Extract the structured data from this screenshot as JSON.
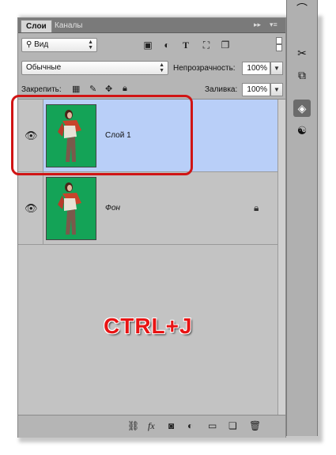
{
  "tabs": {
    "layers": "Слои",
    "channels": "Каналы"
  },
  "filter": {
    "kind": "Вид"
  },
  "blend": {
    "mode": "Обычные",
    "opacity_label": "Непрозрачность:",
    "opacity_value": "100%"
  },
  "lock": {
    "label": "Закрепить:",
    "fill_label": "Заливка:",
    "fill_value": "100%"
  },
  "layers": [
    {
      "name": "Слой 1",
      "selected": true,
      "locked": false
    },
    {
      "name": "Фон",
      "selected": false,
      "locked": true
    }
  ],
  "overlay": {
    "shortcut": "CTRL+J"
  },
  "colors": {
    "selected_row": "#b9cff8",
    "highlight": "#d01414",
    "thumbnail_bg": "#14a357"
  }
}
